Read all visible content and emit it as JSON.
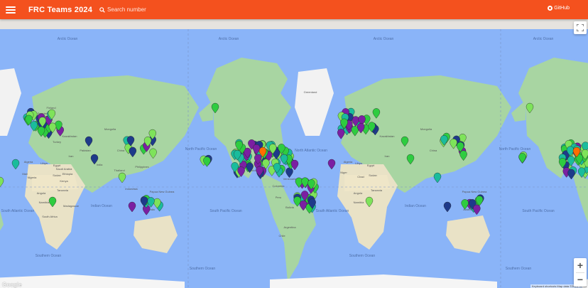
{
  "appbar": {
    "title": "FRC Teams 2024",
    "search_placeholder": "Search number",
    "github_label": "GitHub",
    "color": "#f4511e"
  },
  "map": {
    "ocean_labels": [
      "Arctic Ocean",
      "North Pacific Ocean",
      "North Atlantic Ocean",
      "South Pacific Ocean",
      "South Atlantic Ocean",
      "Indian Ocean",
      "Southern Ocean"
    ],
    "place_labels": [
      "Greenland",
      "Kazakhstan",
      "Mongolia",
      "China",
      "Iran",
      "Libya",
      "Egypt",
      "Sudan",
      "Algeria",
      "Mali",
      "Niger",
      "Chad",
      "Angola",
      "Tanzania",
      "Namibia",
      "Madagascar",
      "Australia",
      "Papua New Guinea",
      "Mexico",
      "Venezuela",
      "Peru",
      "Brazil",
      "Bolivia",
      "Colombia",
      "Argentina",
      "Chile",
      "Sweden",
      "Finland",
      "Ukraine",
      "Saudi Arabia",
      "India",
      "Indonesia",
      "Philippines",
      "Pakistan",
      "Turkey",
      "Thailand",
      "Kenya",
      "South Africa",
      "Ethiopia",
      "Nigeria"
    ],
    "marker_colors": {
      "green": "#2ecc40",
      "light_green": "#7ee35a",
      "teal": "#1abc9c",
      "purple": "#7b1fa2",
      "blue": "#1e3a8a",
      "orange": "#ff6d00"
    },
    "google_label": "Google",
    "attribution": "Keyboard shortcuts  Map data ©2024  Terms"
  },
  "controls": {
    "zoom_in": "+",
    "zoom_out": "−"
  }
}
